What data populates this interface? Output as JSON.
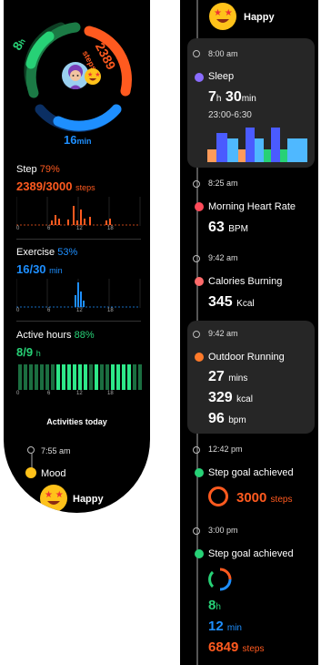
{
  "ring": {
    "hours": "8",
    "hours_unit": "h",
    "steps": "2389",
    "steps_unit": "steps",
    "minutes": "16",
    "minutes_unit": "min"
  },
  "stats": {
    "step": {
      "label": "Step",
      "pct": "79%",
      "value": "2389/3000",
      "unit": "steps"
    },
    "exercise": {
      "label": "Exercise",
      "pct": "53%",
      "value": "16/30",
      "unit": "min"
    },
    "active": {
      "label": "Active hours",
      "pct": "88%",
      "value": "8/9",
      "unit": "h"
    },
    "axis_ticks": [
      "0",
      "6",
      "12",
      "18"
    ]
  },
  "activities_today": "Activities today",
  "left_timeline": {
    "time": "7:55 am",
    "mood_label": "Mood",
    "mood_value": "Happy"
  },
  "right": {
    "top_mood": "Happy",
    "sleep": {
      "time": "8:00 am",
      "title": "Sleep",
      "hours": "7",
      "h_unit": "h",
      "mins": "30",
      "m_unit": "min",
      "range": "23:00-6:30"
    },
    "heart": {
      "time": "8:25 am",
      "title": "Morning Heart Rate",
      "value": "63",
      "unit": "BPM"
    },
    "calories": {
      "time": "9:42 am",
      "title": "Calories Burning",
      "value": "345",
      "unit": "Kcal"
    },
    "running": {
      "time": "9:42 am",
      "title": "Outdoor Running",
      "mins": "27",
      "mins_unit": "mins",
      "kcal": "329",
      "kcal_unit": "kcal",
      "bpm": "96",
      "bpm_unit": "bpm"
    },
    "goal1": {
      "time": "12:42 pm",
      "title": "Step goal achieved",
      "value": "3000",
      "unit": "steps"
    },
    "goal2": {
      "time": "3:00 pm",
      "title": "Step goal achieved",
      "hours": "8",
      "hours_unit": "h",
      "mins": "12",
      "mins_unit": "min",
      "steps": "6849",
      "steps_unit": "steps"
    }
  },
  "colors": {
    "orange": "#ff5a1f",
    "green": "#27d176",
    "blue": "#1e8fff",
    "card": "#262626"
  }
}
